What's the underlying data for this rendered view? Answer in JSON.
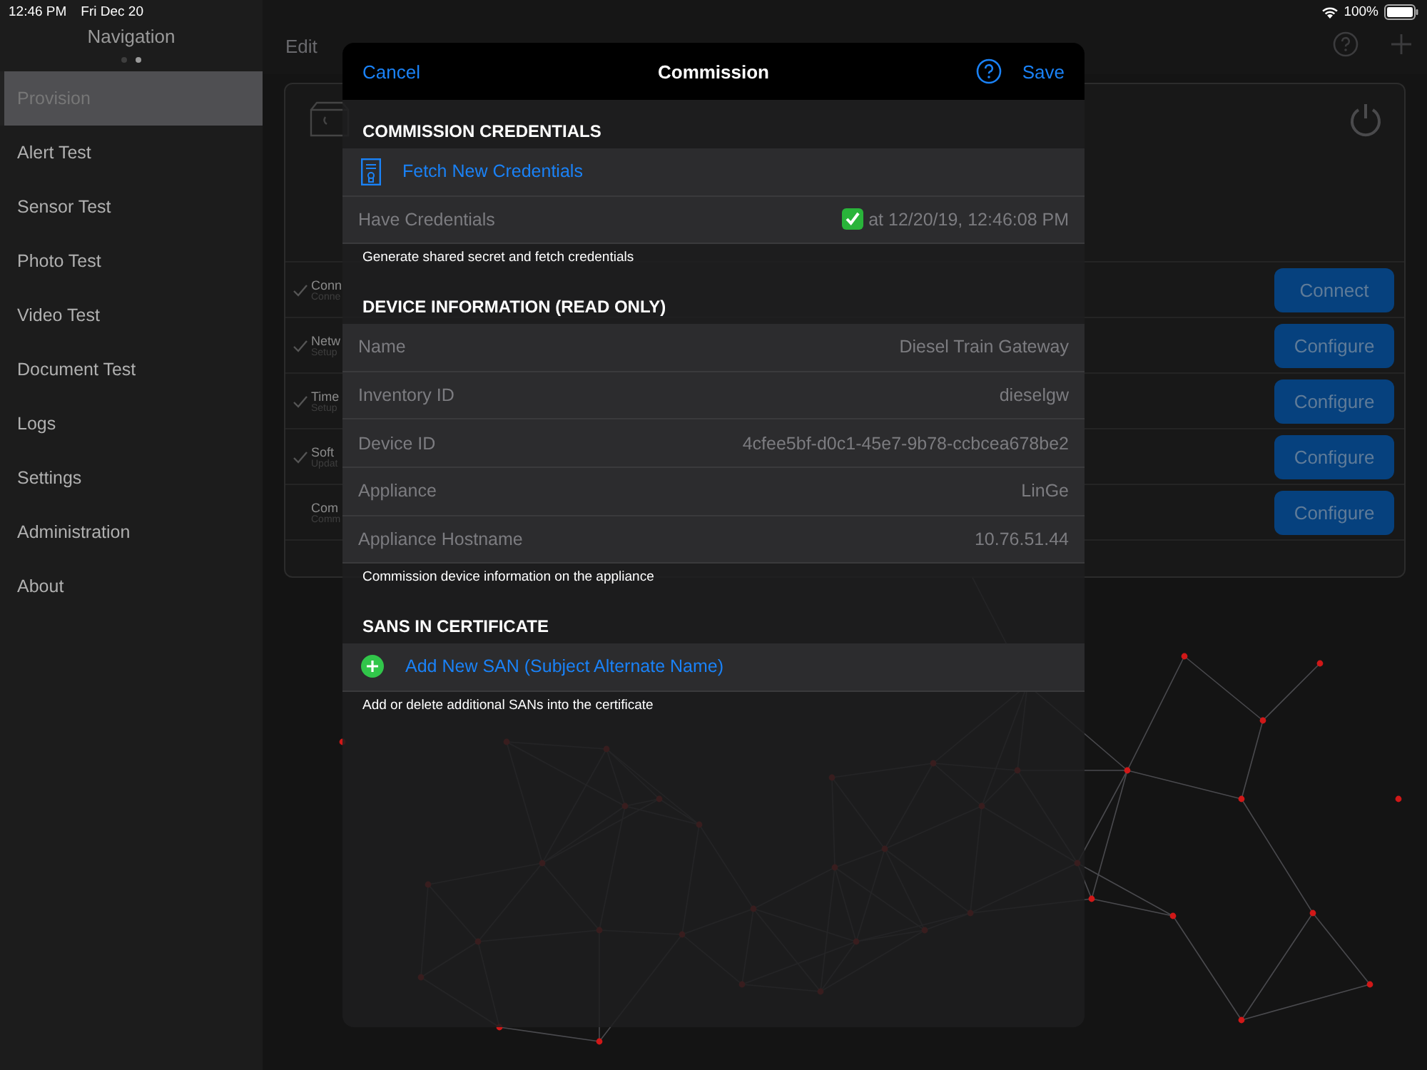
{
  "status_bar": {
    "time": "12:46 PM",
    "date": "Fri Dec 20",
    "battery": "100%"
  },
  "sidebar": {
    "title": "Navigation",
    "page_dots": [
      {
        "selected": false
      },
      {
        "selected": true
      }
    ],
    "items": [
      {
        "label": "Provision",
        "selected": true
      },
      {
        "label": "Alert Test",
        "selected": false
      },
      {
        "label": "Sensor Test",
        "selected": false
      },
      {
        "label": "Photo Test",
        "selected": false
      },
      {
        "label": "Video Test",
        "selected": false
      },
      {
        "label": "Document Test",
        "selected": false
      },
      {
        "label": "Logs",
        "selected": false
      },
      {
        "label": "Settings",
        "selected": false
      },
      {
        "label": "Administration",
        "selected": false
      },
      {
        "label": "About",
        "selected": false
      }
    ]
  },
  "main": {
    "edit_button": "Edit",
    "steps": [
      {
        "title": "Conn",
        "subtitle": "Conne",
        "checked": true,
        "button": "Connect"
      },
      {
        "title": "Netw",
        "subtitle": "Setup",
        "checked": true,
        "button": "Configure"
      },
      {
        "title": "Time",
        "subtitle": "Setup",
        "checked": true,
        "button": "Configure"
      },
      {
        "title": "Soft",
        "subtitle": "Updat",
        "checked": true,
        "button": "Configure"
      },
      {
        "title": "Com",
        "subtitle": "Comm",
        "checked": false,
        "button": "Configure"
      }
    ]
  },
  "modal": {
    "cancel": "Cancel",
    "title": "Commission",
    "save": "Save",
    "sections": [
      {
        "header": "COMMISSION CREDENTIALS",
        "footer": "Generate shared secret and fetch credentials",
        "rows": [
          {
            "kind": "action",
            "label": "Fetch New Credentials"
          },
          {
            "kind": "status",
            "label": "Have Credentials",
            "checked": true,
            "value": "at 12/20/19, 12:46:08 PM"
          }
        ]
      },
      {
        "header": "DEVICE INFORMATION (READ ONLY)",
        "footer": "Commission device information on the appliance",
        "rows": [
          {
            "kind": "field",
            "label": "Name",
            "value": "Diesel Train Gateway"
          },
          {
            "kind": "field",
            "label": "Inventory ID",
            "value": "dieselgw"
          },
          {
            "kind": "field",
            "label": "Device ID",
            "value": "4cfee5bf-d0c1-45e7-9b78-ccbcea678be2"
          },
          {
            "kind": "field",
            "label": "Appliance",
            "value": "LinGe"
          },
          {
            "kind": "field",
            "label": "Appliance Hostname",
            "value": "10.76.51.44"
          }
        ]
      },
      {
        "header": "SANS IN CERTIFICATE",
        "footer": "Add or delete additional SANs into the certificate",
        "rows": [
          {
            "kind": "action",
            "label": "Add New SAN (Subject Alternate Name)"
          }
        ]
      }
    ]
  }
}
